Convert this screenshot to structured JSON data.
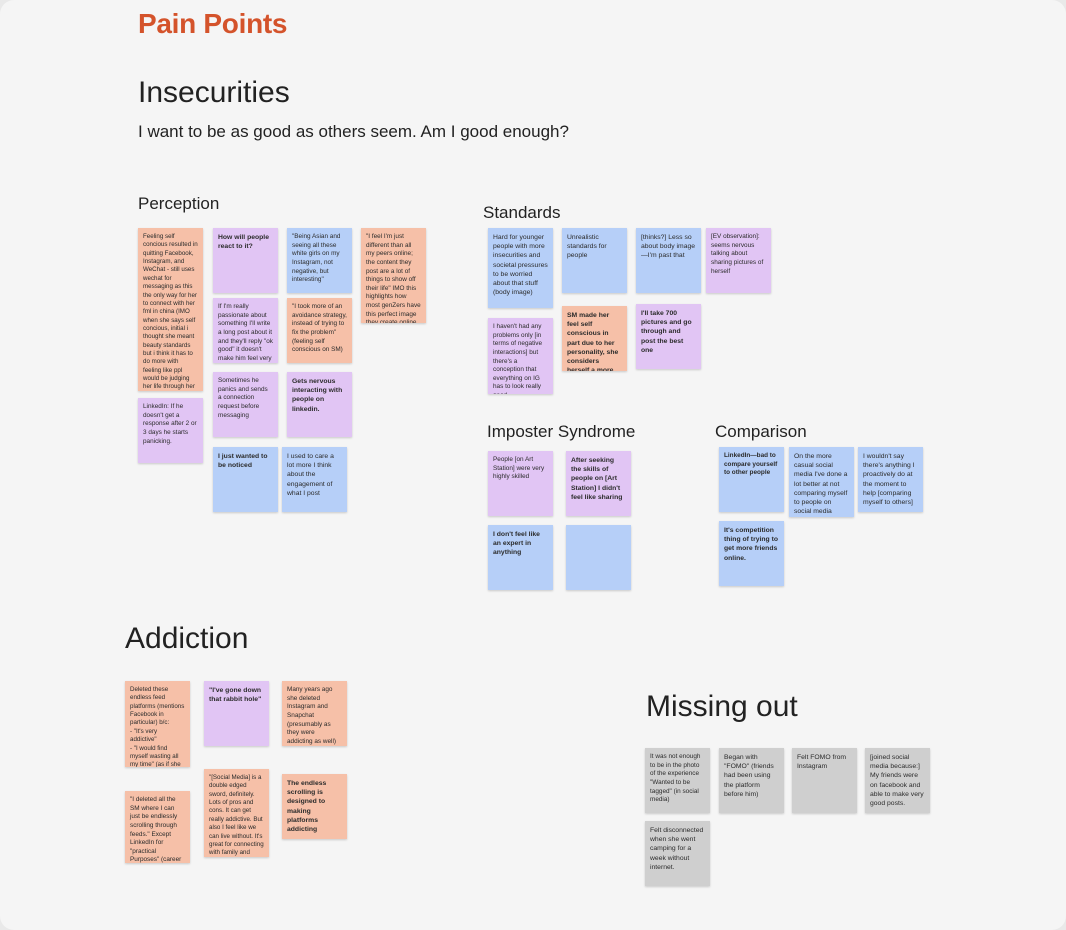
{
  "page_title": "Pain Points",
  "insecurities": {
    "title": "Insecurities",
    "subtitle": "I want to be as good as others seem. Am I good enough?"
  },
  "perception": {
    "title": "Perception",
    "notes": [
      "Feeling self concious resulted in quitting Facebook, Instagram, and WeChat - still uses wechat for messaging as this the only way for her to connect with her fml in china (IMO when she says self concious, initial i thought she meant beauty standards but i think it has to do more with feeling like ppl would be judging her life through her posts and not being confident on how others would percieve them and how that would reflect on her - fear of judgment)",
      "LinkedIn: If he doesn't get a response after 2 or 3 days he starts panicking.",
      "How will people react to it?",
      "If I'm really passionate about something I'll write a long post about it and they'll reply \"ok good\" it doesn't make him feel very good",
      "Sometimes he panics and sends a connection request before messaging",
      "I just wanted to be noticed",
      "\"Being Asian and seeing all these white girls on my Instagram, not negative, but interesting\"",
      "\"I took more of an avoidance strategy, instead of trying to fix the problem\" (feeling self conscious on SM)",
      "Gets nervous interacting with people on linkedin.",
      "I used to care a lot more I think about the engagement of what I post",
      "\"I feel I'm just different than all my peers online; the content they post are a lot of things to show off their life\" IMO this highlights how most genZers have this perfect image they create online and Diana is in the minority by not posting this type of content)"
    ]
  },
  "standards": {
    "title": "Standards",
    "notes": [
      "Hard for younger people with more insecurities and societal pressures to be worried about that stuff (body image)",
      "I haven't had any problems only [in terms of negative interactions] but there's a conception that everything on IG has to look really good",
      "Unrealistic standards for people",
      "SM made her feel self conscious in part due to her personality, she considers herself a more private person",
      "[thinks?] Less so about body image—I'm past that",
      "I'll take 700 pictures and go through and post the best one",
      "[EV observation]: seems nervous talking about sharing pictures of herself"
    ]
  },
  "imposter": {
    "title": "Imposter Syndrome",
    "notes": [
      "People [on Art Station] were very highly skilled",
      "After seeking the skills of people on [Art Station] I didn't feel like sharing",
      "I don't feel like an expert in anything",
      ""
    ]
  },
  "comparison": {
    "title": "Comparison",
    "notes": [
      "LinkedIn—bad to compare yourself to other people",
      "On the more casual social media I've done a lot better at not comparing myself to people on social media",
      "I wouldn't say there's anything I proactively do at the moment to help [comparing myself to others]",
      "It's competition thing of trying to get more friends online."
    ]
  },
  "addiction": {
    "title": "Addiction",
    "notes": [
      "Deleted these endless feed platforms (mentions Facebook in particular) b/c:\n- \"It's very addictive\"\n- \"I would find myself wasting all my time\" (as if she had no control)\n- \"I don't learn anything from it\"",
      "\"I deleted all the SM where I can just be endlessly scrolling through feeds.\" Except LinkedIn for \"practical Purposes\" (career advancement)",
      "\"I've gone down that rabbit hole\"",
      "\"[Social Media] is a double edged sword, definitely. Lots of pros and cons. It can get really addictive. But also I feel like we can live without. It's great for connecting with family and friends who are far away. And there's so many other uses as well.\"",
      "Many years ago she deleted Instagram and Snapchat (presumably as they were addicting as well)",
      "The endless scrolling is designed to making platforms addicting"
    ]
  },
  "missing_out": {
    "title": "Missing out",
    "notes": [
      "It was not enough to be in the photo of the experience \"Wanted to be tagged\" (in social media)",
      "Felt disconnected when she went camping for a week without internet.",
      "Began with \"FOMO\" (friends had been using the platform before him)",
      "Felt FOMO from Instagram",
      "[joined social media because:] My friends were on facebook and able to make very good posts."
    ]
  },
  "colors": {
    "title": "#d4532b",
    "orange_note": "#f6c0a8",
    "purple_note": "#e1c5f4",
    "blue_note": "#b6cff8",
    "gray_note": "#cfcfcf"
  }
}
